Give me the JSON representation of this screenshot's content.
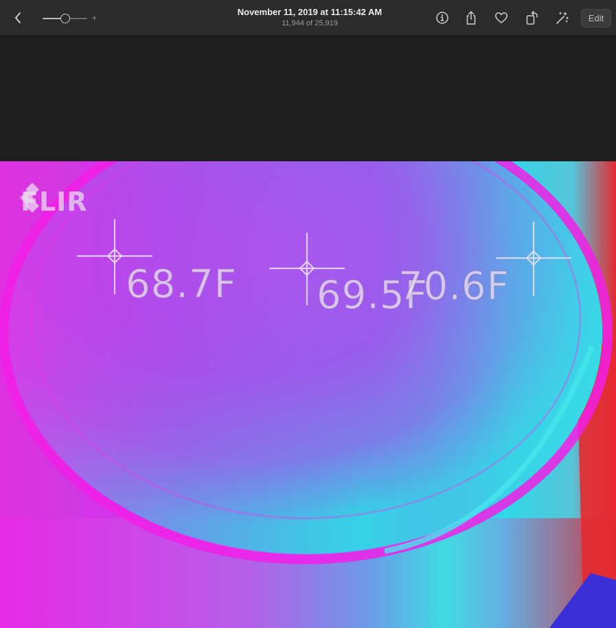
{
  "toolbar": {
    "title": "November 11, 2019 at 11:15:42 AM",
    "subtitle": "11,944 of 25,919",
    "zoom_plus": "+",
    "zoom_level": 0.5,
    "edit_label": "Edit",
    "icons": [
      "back-chevron-icon",
      "info-icon",
      "share-icon",
      "heart-icon",
      "rotate-icon",
      "magic-wand-icon"
    ]
  },
  "photo": {
    "logo_text": "FLIR",
    "readings": [
      {
        "label": "68.7F"
      },
      {
        "label": "69.5F"
      },
      {
        "label": "70.6F"
      }
    ],
    "colors": {
      "magenta": "#f21ee8",
      "violet": "#a24de6",
      "cyan": "#2ed6e6",
      "red": "#e62a30",
      "deep_blue": "#3a2fd6"
    }
  }
}
